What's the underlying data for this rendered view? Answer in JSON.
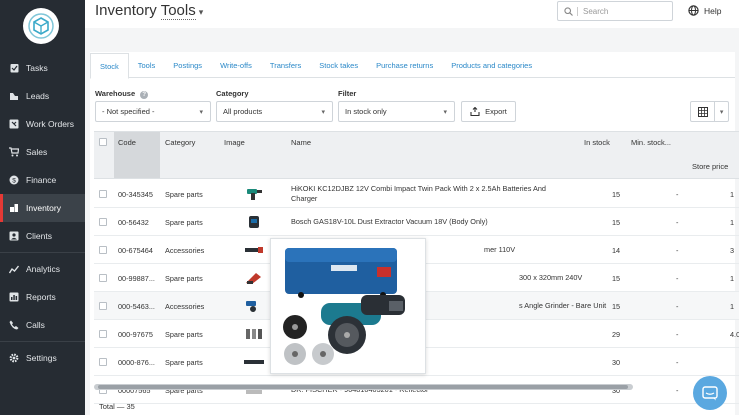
{
  "sidebar": {
    "items": [
      {
        "label": "Tasks",
        "icon": "clipboard-icon"
      },
      {
        "label": "Leads",
        "icon": "leads-icon"
      },
      {
        "label": "Work Orders",
        "icon": "work-orders-icon"
      },
      {
        "label": "Sales",
        "icon": "cart-icon"
      },
      {
        "label": "Finance",
        "icon": "coin-icon"
      },
      {
        "label": "Inventory",
        "icon": "inventory-icon",
        "active": true
      },
      {
        "label": "Clients",
        "icon": "clients-icon"
      },
      {
        "label": "Analytics",
        "icon": "analytics-icon"
      },
      {
        "label": "Reports",
        "icon": "reports-icon"
      },
      {
        "label": "Calls",
        "icon": "phone-icon"
      },
      {
        "label": "Settings",
        "icon": "gear-icon"
      }
    ]
  },
  "header": {
    "title": "Inventory",
    "subtitle": "Tools",
    "search_placeholder": "Search",
    "help_label": "Help"
  },
  "tabs": [
    "Stock",
    "Tools",
    "Postings",
    "Write-offs",
    "Transfers",
    "Stock takes",
    "Purchase returns",
    "Products and categories"
  ],
  "filters": {
    "warehouse_label": "Warehouse",
    "warehouse_value": "- Not specified -",
    "category_label": "Category",
    "category_value": "All products",
    "filter_label": "Filter",
    "filter_value": "In stock only",
    "export_label": "Export"
  },
  "table": {
    "columns": {
      "code": "Code",
      "category": "Category",
      "image": "Image",
      "name": "Name",
      "in_stock": "In stock",
      "min_stock": "Min. stock...",
      "store_price": "Store price"
    },
    "rows": [
      {
        "code": "00-345345",
        "category": "Spare parts",
        "name": "HiKOKI KC12DJBZ 12V Combi Impact Twin Pack With 2 x 2.5Ah Batteries And Charger",
        "in_stock": "15",
        "min_stock": "-",
        "price": "1"
      },
      {
        "code": "00-56432",
        "category": "Spare parts",
        "name": "Bosch GAS18V-10L Dust Extractor Vacuum 18V (Body Only)",
        "in_stock": "15",
        "min_stock": "-",
        "price": "1"
      },
      {
        "code": "00-675464",
        "category": "Accessories",
        "name": "mer 110V",
        "in_stock": "14",
        "min_stock": "-",
        "price": "3"
      },
      {
        "code": "00-99887...",
        "category": "Spare parts",
        "name": "300 x 320mm 240V",
        "in_stock": "15",
        "min_stock": "-",
        "price": "1"
      },
      {
        "code": "000-5463...",
        "category": "Accessories",
        "name": "s Angle Grinder - Bare Unit",
        "in_stock": "15",
        "min_stock": "-",
        "price": "1"
      },
      {
        "code": "000-97675",
        "category": "Spare parts",
        "name": "",
        "in_stock": "29",
        "min_stock": "-",
        "price": "4.0"
      },
      {
        "code": "0000-876...",
        "category": "Spare parts",
        "name": "",
        "in_stock": "30",
        "min_stock": "-",
        "price": ""
      },
      {
        "code": "00007565",
        "category": "Spare parts",
        "name": "DR. FISCHER - 964810403201 - Reflector",
        "in_stock": "30",
        "min_stock": "-",
        "price": ""
      }
    ],
    "total": "Total — 35"
  }
}
